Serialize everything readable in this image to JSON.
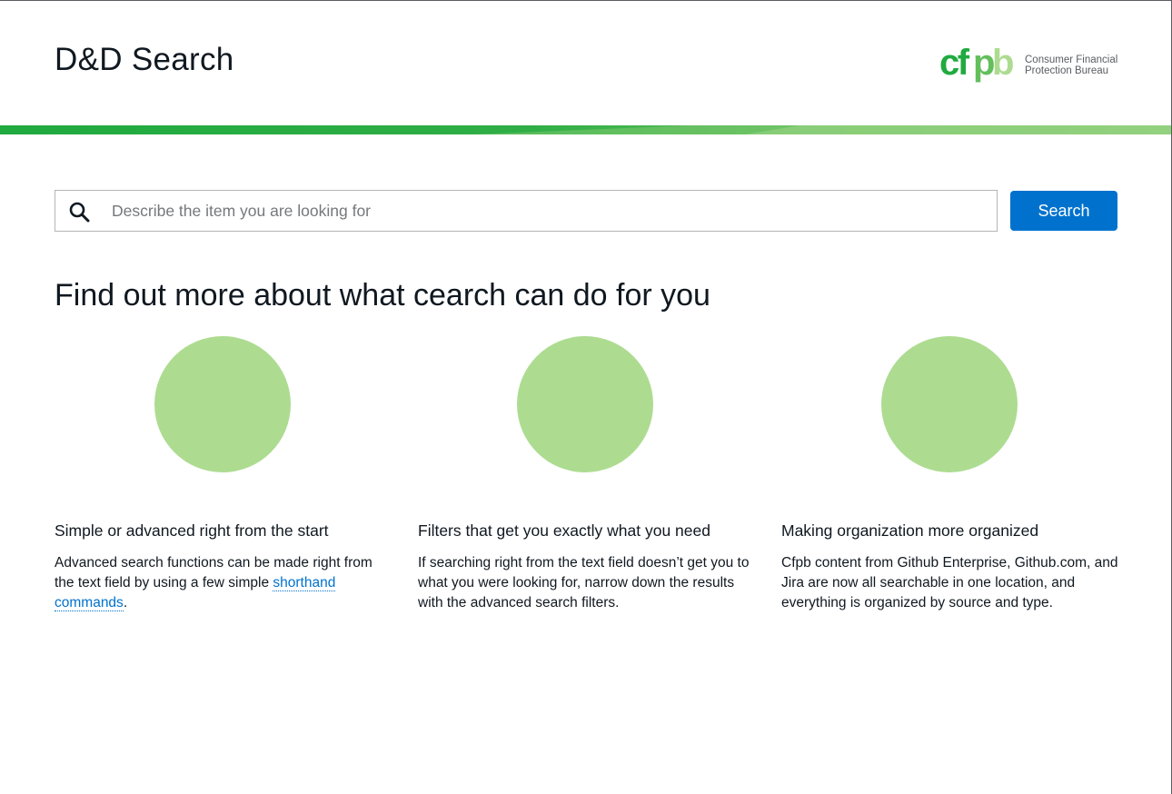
{
  "header": {
    "title": "D&D Search",
    "logo": {
      "mark_text": "cfpb",
      "line1": "Consumer Financial",
      "line2": "Protection Bureau"
    }
  },
  "colors": {
    "brand_green": "#20aa3f",
    "light_green": "#addc91",
    "primary_blue": "#0072ce"
  },
  "search": {
    "placeholder": "Describe the item you are looking for",
    "value": "",
    "button_label": "Search",
    "icon": "search-icon"
  },
  "intro": {
    "heading": "Find out more about what cearch can do for you"
  },
  "features": [
    {
      "title": "Simple or advanced right from the start",
      "body_before": "Advanced search functions can be made right from the text field by using a few simple ",
      "link_text": "shorthand commands",
      "body_after": "."
    },
    {
      "title": "Filters that get you exactly what you need",
      "body": "If searching right from the text field doesn’t get you to what you were looking for, narrow down the results with the advanced search filters."
    },
    {
      "title": "Making organization more organized",
      "body": "Cfpb content from Github Enterprise, Github.com, and Jira are now all searchable in one location, and everything is organized by source and type."
    }
  ]
}
